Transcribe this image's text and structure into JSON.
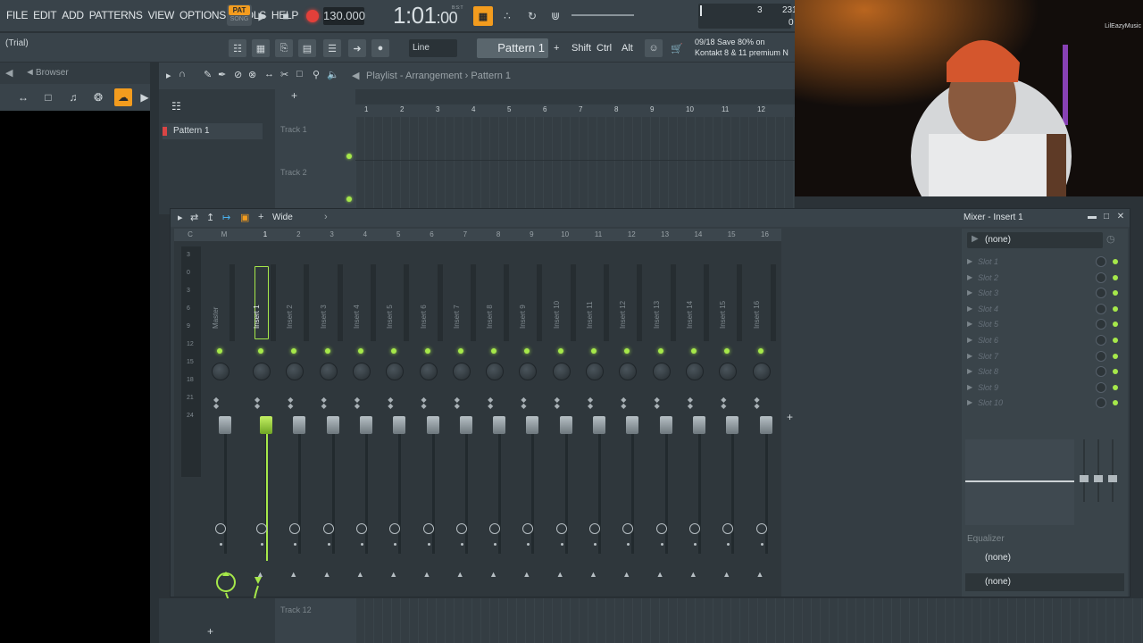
{
  "menu": [
    "FILE",
    "EDIT",
    "ADD",
    "PATTERNS",
    "VIEW",
    "OPTIONS",
    "TOOLS",
    "HELP"
  ],
  "transport": {
    "pat_label": "PAT",
    "song_label": "SONG",
    "tempo": "130.000",
    "time": "1:01",
    "time_ticks": ":00",
    "time_sub": "B:S:T"
  },
  "cpu": {
    "value1": "3",
    "value2": "231",
    "value3": "0"
  },
  "toolbar2": {
    "hint": "(Trial)",
    "line_mode": "Line",
    "pattern": "Pattern 1",
    "plus": "+",
    "shift": "Shift",
    "ctrl": "Ctrl",
    "alt": "Alt"
  },
  "news": {
    "line1": "09/18  Save 80% on",
    "line2": "Kontakt 8 & 11 premium N"
  },
  "browser": {
    "title": "Browser"
  },
  "playlist": {
    "title": "Playlist - Arrangement",
    "breadcrumb_pattern": "Pattern 1",
    "pattern_item": "Pattern 1",
    "tracks": [
      "Track 1",
      "Track 2"
    ],
    "bars": [
      "1",
      "2",
      "3",
      "4",
      "5",
      "6",
      "7",
      "8",
      "9",
      "10",
      "11",
      "12"
    ],
    "bottom_track": "Track 12"
  },
  "webcam": {
    "logo": "LilEazyMusic"
  },
  "mixer": {
    "title": "Mixer - Insert 1",
    "view_mode": "Wide",
    "channel_numbers": [
      "C",
      "M",
      "1",
      "2",
      "3",
      "4",
      "5",
      "6",
      "7",
      "8",
      "9",
      "10",
      "11",
      "12",
      "13",
      "14",
      "15",
      "16"
    ],
    "scale": [
      "3",
      "0",
      "3",
      "6",
      "9",
      "12",
      "15",
      "18",
      "21",
      "24"
    ],
    "master_label": "Master",
    "inserts": [
      "Insert 1",
      "Insert 2",
      "Insert 3",
      "Insert 4",
      "Insert 5",
      "Insert 6",
      "Insert 7",
      "Insert 8",
      "Insert 9",
      "Insert 10",
      "Insert 11",
      "Insert 12",
      "Insert 13",
      "Insert 14",
      "Insert 15",
      "Insert 16"
    ],
    "selected_insert": "Insert 1",
    "fx_input": "(none)",
    "slots": [
      "Slot 1",
      "Slot 2",
      "Slot 3",
      "Slot 4",
      "Slot 5",
      "Slot 6",
      "Slot 7",
      "Slot 8",
      "Slot 9",
      "Slot 10"
    ],
    "eq_label": "Equalizer",
    "output1": "(none)",
    "output2": "(none)",
    "add_label": "+"
  },
  "colors": {
    "accent_orange": "#f39c1e",
    "led_green": "#a6e84a",
    "record_red": "#e2403a"
  }
}
